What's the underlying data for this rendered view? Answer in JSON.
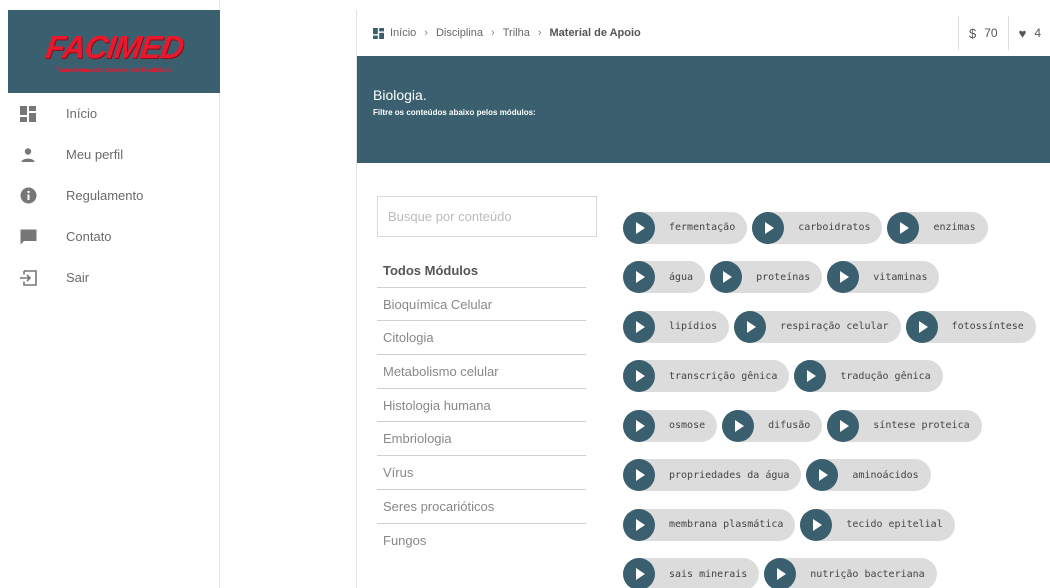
{
  "sidebar": {
    "logo": {
      "name": "FACIMED",
      "tagline": "Transformando Sonhos em Realidade"
    },
    "items": [
      {
        "label": "Início",
        "icon": "dashboard-icon"
      },
      {
        "label": "Meu perfil",
        "icon": "person-icon"
      },
      {
        "label": "Regulamento",
        "icon": "info-icon"
      },
      {
        "label": "Contato",
        "icon": "chat-icon"
      },
      {
        "label": "Sair",
        "icon": "logout-icon"
      }
    ]
  },
  "header": {
    "breadcrumb": [
      "Início",
      "Disciplina",
      "Trilha",
      "Material de Apoio"
    ],
    "coins": {
      "symbol": "$",
      "value": "70"
    },
    "likes": {
      "symbol": "♥",
      "value": "4"
    }
  },
  "banner": {
    "title": "Biologia.",
    "subtitle": "Filtre os conteúdos abaixo pelos módulos:"
  },
  "search": {
    "placeholder": "Busque por conteúdo"
  },
  "modules": [
    "Todos Módulos",
    "Bioquímica Celular",
    "Citologia",
    "Metabolismo celular",
    "Histologia humana",
    "Embriologia",
    "Vírus",
    "Seres procarióticos",
    "Fungos"
  ],
  "contents": [
    [
      "fermentação",
      "carboidratos",
      "enzimas"
    ],
    [
      "água",
      "proteínas",
      "vitaminas"
    ],
    [
      "lipídios",
      "respiração celular",
      "fotossíntese"
    ],
    [
      "transcrição gênica",
      "tradução gênica"
    ],
    [
      "osmose",
      "difusão",
      "síntese proteica"
    ],
    [
      "propriedades da água",
      "aminoácidos"
    ],
    [
      "membrana plasmática",
      "tecido epitelial"
    ],
    [
      "sais minerais",
      "nutrição bacteriana"
    ]
  ],
  "colors": {
    "brand": "#3a5f6e",
    "logo_red": "#e8192c",
    "chip_bg": "#dcdcdc"
  }
}
